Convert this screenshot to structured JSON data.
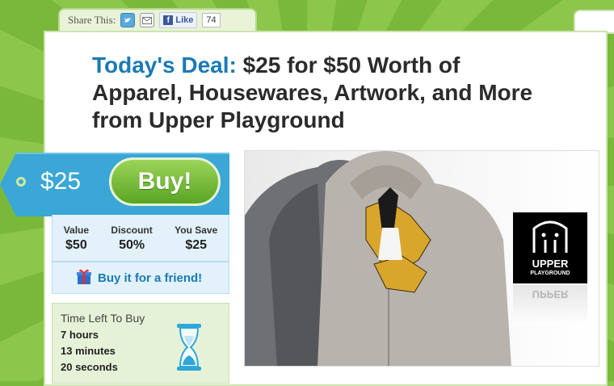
{
  "share": {
    "label": "Share This:",
    "like_label": "Like",
    "like_count": "74",
    "icons": [
      "twitter-icon",
      "mail-icon",
      "facebook-icon"
    ]
  },
  "deal": {
    "lead": "Today's Deal:",
    "title": "$25 for $50 Worth of Apparel, Housewares, Artwork, and More from Upper Playground"
  },
  "purchase": {
    "price": "$25",
    "buy_label": "Buy!"
  },
  "stats": {
    "value_label": "Value",
    "value": "$50",
    "discount_label": "Discount",
    "discount": "50%",
    "save_label": "You Save",
    "save": "$25"
  },
  "gift": {
    "label": "Buy it for a friend!"
  },
  "timer": {
    "title": "Time Left To Buy",
    "hours": "7 hours",
    "minutes": "13 minutes",
    "seconds": "20 seconds"
  },
  "brand": {
    "name": "UPPER",
    "sub": "PLAYGROUND",
    "reflection": "UPPER"
  },
  "colors": {
    "accent_blue": "#1a7ab6",
    "buy_green": "#5aa523",
    "tag_blue": "#3aa7d6",
    "background_green": "#8cc64a"
  }
}
